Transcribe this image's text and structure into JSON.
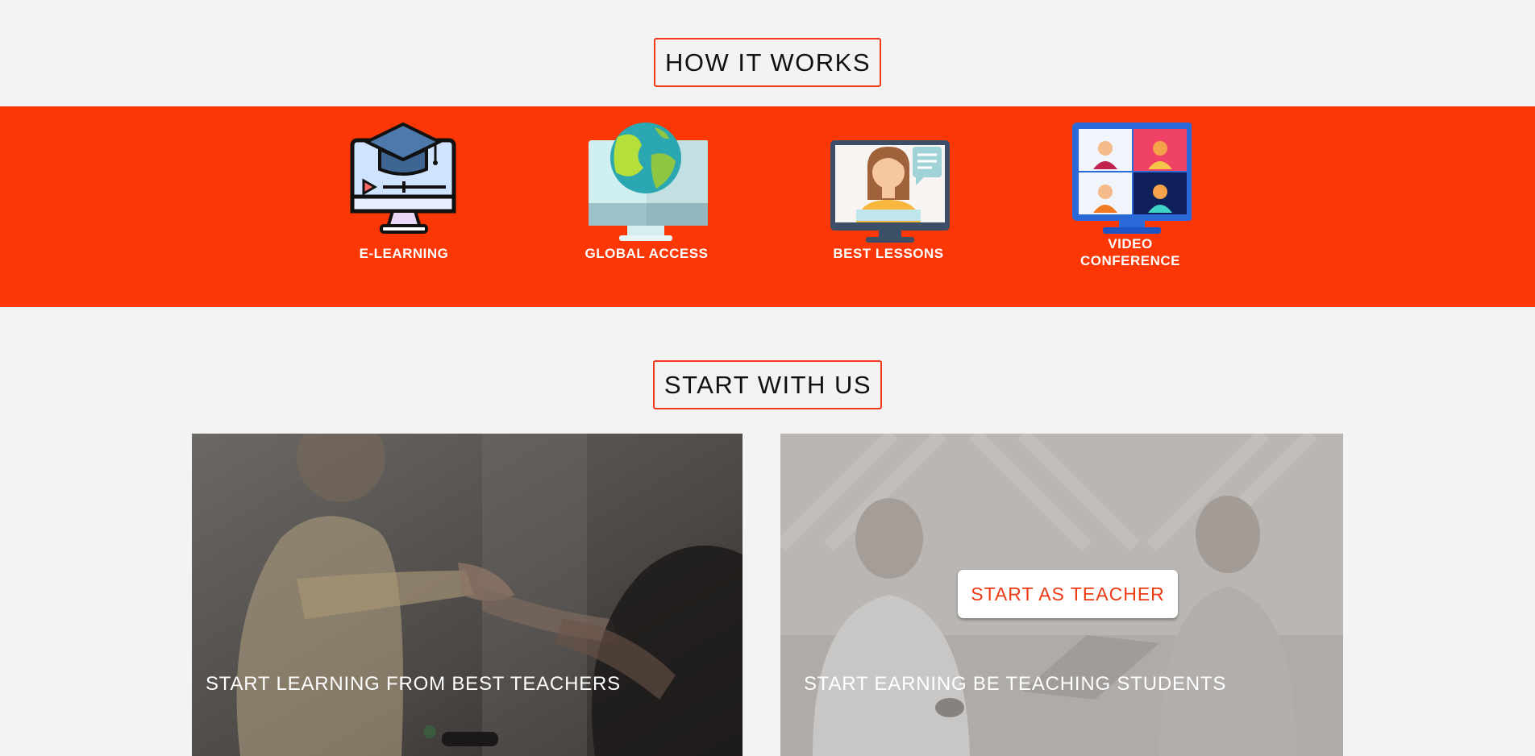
{
  "sections": {
    "how_it_works": {
      "title": "HOW IT WORKS"
    },
    "start_with_us": {
      "title": "START WITH US"
    }
  },
  "features": [
    {
      "label": "E-LEARNING",
      "icon": "e-learning-monitor-icon"
    },
    {
      "label": "GLOBAL ACCESS",
      "icon": "globe-monitor-icon"
    },
    {
      "label": "BEST LESSONS",
      "icon": "teacher-monitor-icon"
    },
    {
      "label_line1": "VIDEO",
      "label_line2": "CONFERENCE",
      "icon": "video-conference-icon"
    }
  ],
  "cards": {
    "learning": {
      "caption": "START LEARNING FROM BEST TEACHERS",
      "image": "handshake-photo"
    },
    "teaching": {
      "caption": "START EARNING BE TEACHING STUDENTS",
      "button": "START AS TEACHER",
      "image": "meeting-photo"
    }
  },
  "colors": {
    "accent": "#fa3705",
    "page_bg": "#f3f3f3",
    "button_text": "#ee3a12"
  }
}
